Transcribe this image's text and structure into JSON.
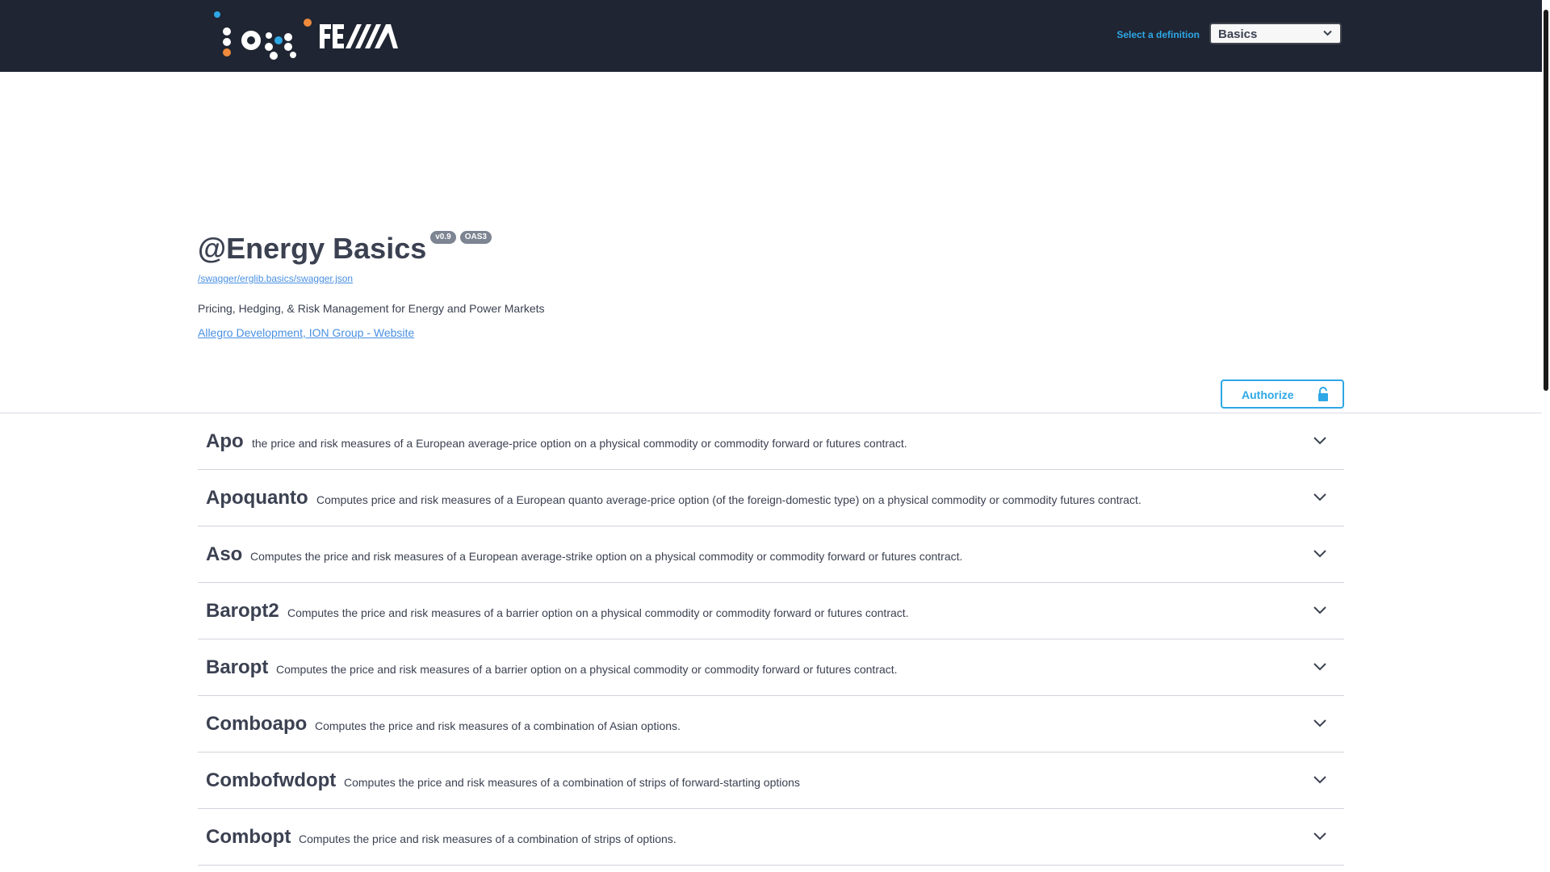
{
  "header": {
    "logo_ion": "iON",
    "logo_fea": "FEA",
    "definition_label": "Select a definition",
    "definition_selected": "Basics"
  },
  "info": {
    "title": "@Energy Basics",
    "version_badge": "v0.9",
    "oas_badge": "OAS3",
    "spec_url": "/swagger/erglib.basics/swagger.json",
    "description": "Pricing, Hedging, & Risk Management for Energy and Power Markets",
    "contact": "Allegro Development, ION Group - Website"
  },
  "auth": {
    "label": "Authorize"
  },
  "tags": [
    {
      "name": "Apo",
      "description": "the price and risk measures of a European average-price option on a physical commodity or commodity forward or futures contract."
    },
    {
      "name": "Apoquanto",
      "description": "Computes price and risk measures of a European quanto average-price option (of the foreign-domestic type) on a physical commodity or commodity futures contract."
    },
    {
      "name": "Aso",
      "description": "Computes the price and risk measures of a European average-strike option on a physical commodity or commodity forward or futures contract."
    },
    {
      "name": "Baropt2",
      "description": "Computes the price and risk measures of a barrier option on a physical commodity or commodity forward or futures contract."
    },
    {
      "name": "Baropt",
      "description": "Computes the price and risk measures of a barrier option on a physical commodity or commodity forward or futures contract."
    },
    {
      "name": "Comboapo",
      "description": "Computes the price and risk measures of a combination of Asian options."
    },
    {
      "name": "Combofwdopt",
      "description": "Computes the price and risk measures of a combination of strips of forward-starting options"
    },
    {
      "name": "Combopt",
      "description": "Computes the price and risk measures of a combination of strips of options."
    }
  ],
  "colors": {
    "topbar": "#1f2532",
    "accent": "#2ea7e6",
    "link": "#4990e2",
    "text": "#3b4151",
    "logo_orange": "#f08a3c"
  }
}
